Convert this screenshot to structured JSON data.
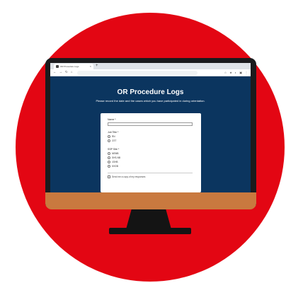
{
  "browser": {
    "tab_title": "OR Procedure Logs",
    "tab_close": "×",
    "new_tab": "+",
    "nav_icons": [
      "back-icon",
      "forward-icon",
      "reload-icon",
      "home-icon"
    ],
    "nav_glyphs": [
      "←",
      "→",
      "↻",
      "⌂"
    ],
    "tool_glyphs": [
      "☆",
      "★",
      "◐",
      "▣",
      "⋮"
    ]
  },
  "form": {
    "title": "OR Procedure Logs",
    "subtitle": "Please record the date and the cases which you have participated in during orientation.",
    "name_label": "Name *",
    "job_title_label": "Job Title *",
    "job_title_options": [
      "RN",
      "CST"
    ],
    "surgery_site_label": "SSP Site *",
    "surgery_site_options": [
      "MEMB",
      "SHS-NB",
      "JOHB",
      "KHOB"
    ],
    "copy_responses_label": "Send me a copy of my responses"
  },
  "colors": {
    "background_circle": "#e30613",
    "page_background": "#0b355f",
    "monitor_frame": "#1b1b1d",
    "monitor_chin": "#c9793f"
  }
}
